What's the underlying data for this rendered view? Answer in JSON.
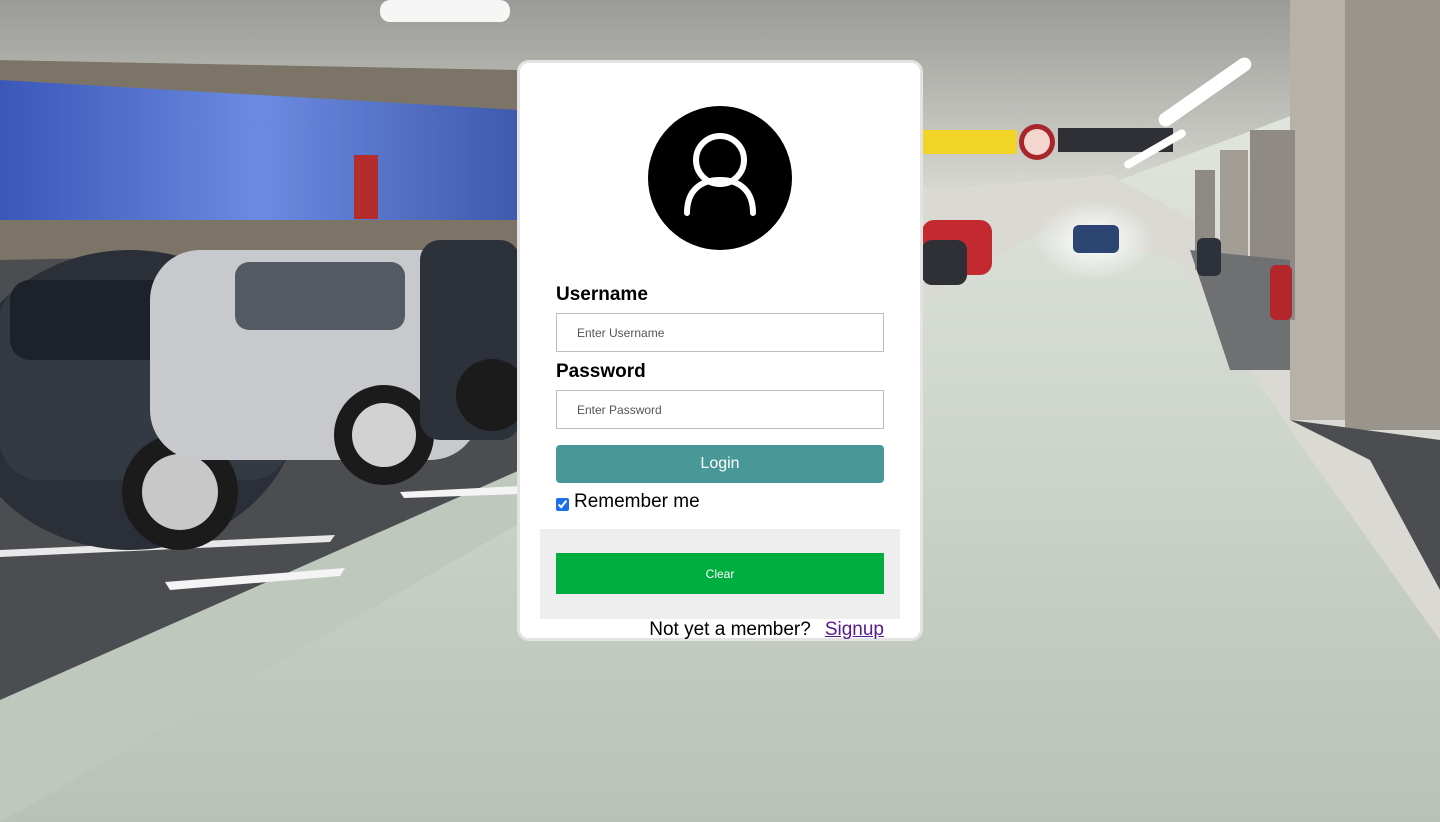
{
  "login": {
    "username_label": "Username",
    "username_placeholder": "Enter Username",
    "password_label": "Password",
    "password_placeholder": "Enter Password",
    "login_label": "Login",
    "remember_label": "Remember me",
    "remember_checked": true,
    "clear_label": "Clear",
    "signup_prompt": "Not yet a member?",
    "signup_link": "Signup"
  },
  "icons": {
    "avatar": "user-avatar-icon"
  },
  "colors": {
    "login_button": "#489898",
    "clear_button": "#00ae3f",
    "link": "#551a8b"
  }
}
